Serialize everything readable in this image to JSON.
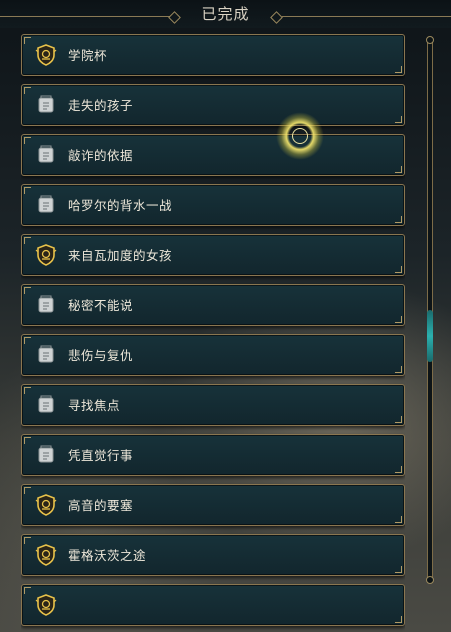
{
  "header": {
    "title": "已完成"
  },
  "colors": {
    "accent_gold": "#b09a66",
    "row_bg": "#17323a",
    "scroll_thumb": "#2bb0ae"
  },
  "quests": [
    {
      "label": "学院杯",
      "icon": "crest-icon"
    },
    {
      "label": "走失的孩子",
      "icon": "scroll-icon"
    },
    {
      "label": "敲诈的依据",
      "icon": "scroll-icon"
    },
    {
      "label": "哈罗尔的背水一战",
      "icon": "scroll-icon"
    },
    {
      "label": "来自瓦加度的女孩",
      "icon": "crest-icon"
    },
    {
      "label": "秘密不能说",
      "icon": "scroll-icon"
    },
    {
      "label": "悲伤与复仇",
      "icon": "scroll-icon"
    },
    {
      "label": "寻找焦点",
      "icon": "scroll-icon"
    },
    {
      "label": "凭直觉行事",
      "icon": "scroll-icon"
    },
    {
      "label": "高音的要塞",
      "icon": "crest-icon"
    },
    {
      "label": "霍格沃茨之途",
      "icon": "crest-icon"
    },
    {
      "label": "",
      "icon": "crest-icon"
    }
  ]
}
